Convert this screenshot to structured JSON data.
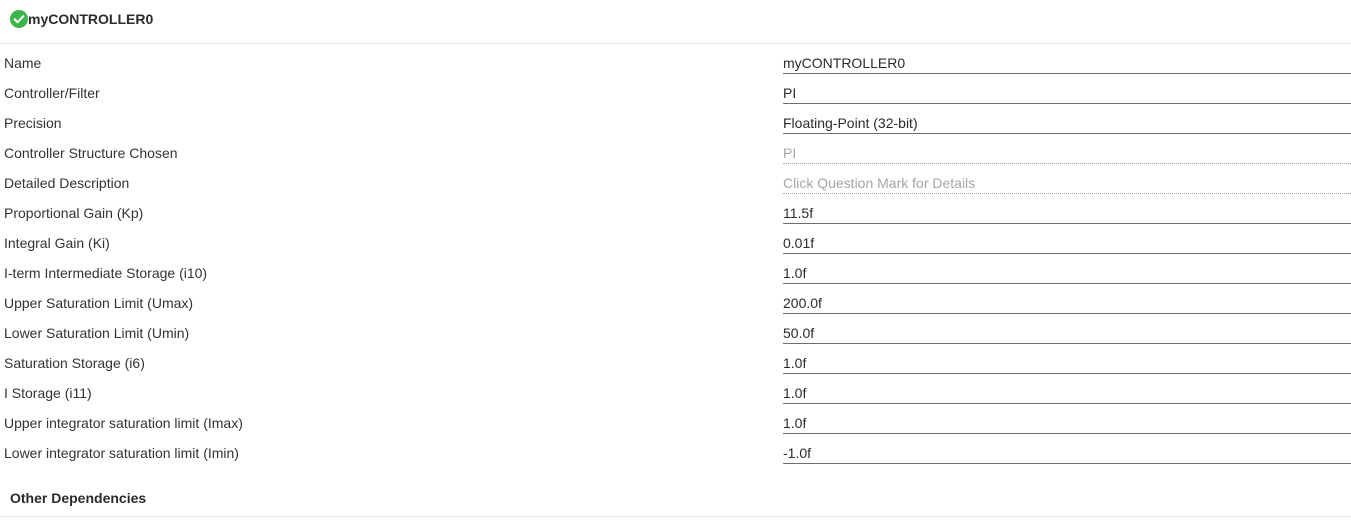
{
  "header": {
    "title": "myCONTROLLER0",
    "status_icon": "check-circle-icon",
    "status_color": "#3bb54a"
  },
  "properties": [
    {
      "label": "Name",
      "value": "myCONTROLLER0",
      "editable": true
    },
    {
      "label": "Controller/Filter",
      "value": "PI",
      "editable": true
    },
    {
      "label": "Precision",
      "value": "Floating-Point (32-bit)",
      "editable": true
    },
    {
      "label": "Controller Structure Chosen",
      "value": "PI",
      "editable": false
    },
    {
      "label": "Detailed Description",
      "value": "Click Question Mark for Details",
      "editable": false
    },
    {
      "label": "Proportional Gain (Kp)",
      "value": "11.5f",
      "editable": true
    },
    {
      "label": "Integral Gain (Ki)",
      "value": "0.01f",
      "editable": true
    },
    {
      "label": "I-term Intermediate Storage (i10)",
      "value": "1.0f",
      "editable": true
    },
    {
      "label": "Upper Saturation Limit (Umax)",
      "value": "200.0f",
      "editable": true
    },
    {
      "label": "Lower Saturation Limit (Umin)",
      "value": "50.0f",
      "editable": true
    },
    {
      "label": "Saturation Storage (i6)",
      "value": "1.0f",
      "editable": true
    },
    {
      "label": "I Storage (i11)",
      "value": "1.0f",
      "editable": true
    },
    {
      "label": "Upper integrator saturation limit (Imax)",
      "value": "1.0f",
      "editable": true
    },
    {
      "label": "Lower integrator saturation limit (Imin)",
      "value": "-1.0f",
      "editable": true
    }
  ],
  "sections": {
    "other_dependencies": "Other Dependencies"
  }
}
